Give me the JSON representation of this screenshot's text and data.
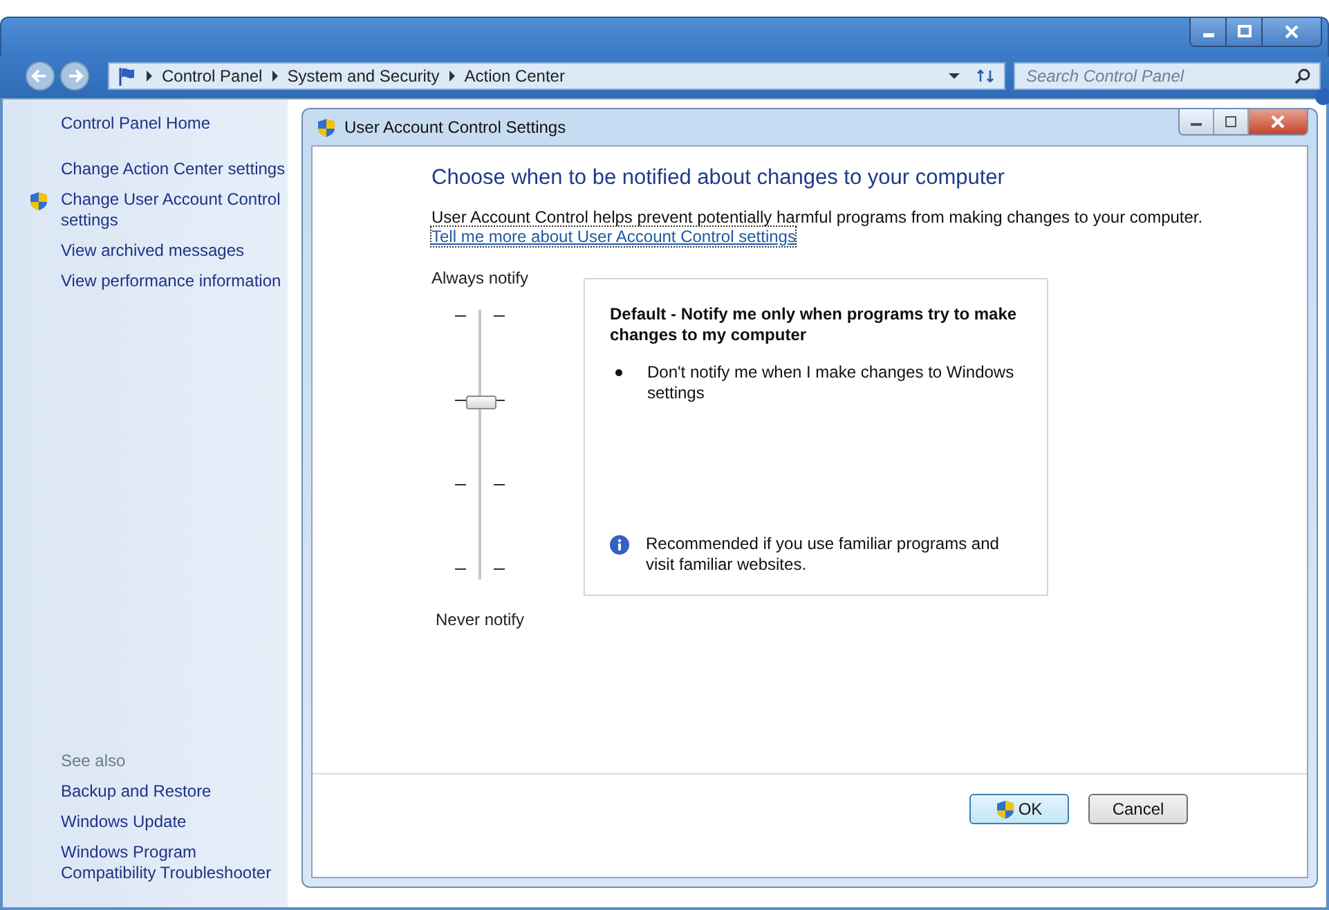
{
  "breadcrumb": [
    "Control Panel",
    "System and Security",
    "Action Center"
  ],
  "search": {
    "placeholder": "Search Control Panel"
  },
  "sidebar": {
    "home": "Control Panel Home",
    "items": [
      {
        "label": "Change Action Center settings",
        "shield": false
      },
      {
        "label": "Change User Account Control settings",
        "shield": true
      },
      {
        "label": "View archived messages",
        "shield": false
      },
      {
        "label": "View performance information",
        "shield": false
      }
    ],
    "see_also": {
      "title": "See also",
      "items": [
        "Backup and Restore",
        "Windows Update",
        "Windows Program Compatibility Troubleshooter"
      ]
    }
  },
  "dialog": {
    "title": "User Account Control Settings",
    "heading": "Choose when to be notified about changes to your computer",
    "description": "User Account Control helps prevent potentially harmful programs from making changes to your computer.",
    "link": "Tell me more about User Account Control settings",
    "slider": {
      "top_label": "Always notify",
      "bottom_label": "Never notify",
      "level": 0.667
    },
    "info": {
      "title": "Default - Notify me only when programs try to make changes to my computer",
      "bullets": [
        "Don't notify me when I make changes to Windows settings"
      ],
      "note": "Recommended if you use familiar programs and visit familiar websites."
    },
    "buttons": [
      {
        "label": "OK",
        "kind": "shield"
      },
      {
        "label": "Cancel",
        "kind": "plain"
      }
    ]
  }
}
